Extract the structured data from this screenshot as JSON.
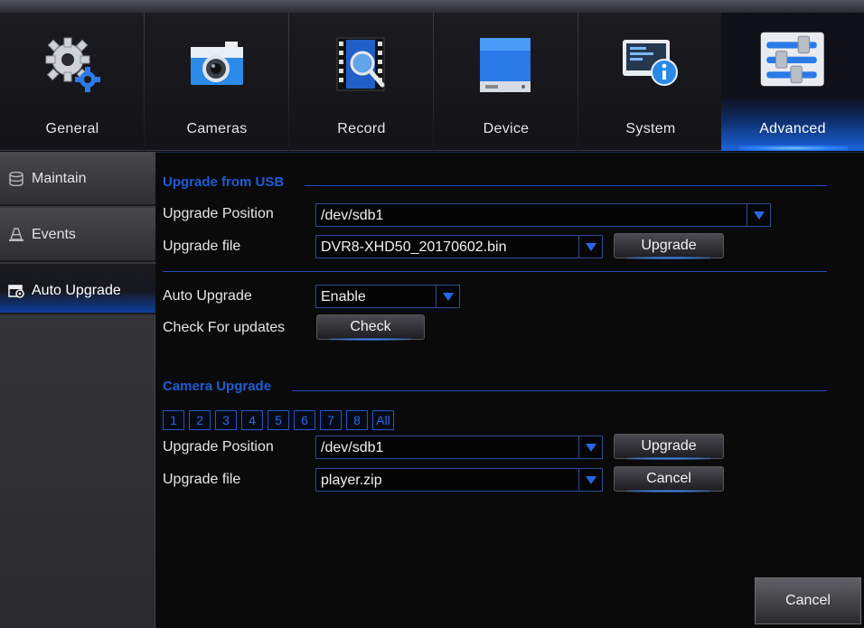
{
  "nav": {
    "tabs": [
      {
        "label": "General",
        "icon": "gear-icon"
      },
      {
        "label": "Cameras",
        "icon": "camera-icon"
      },
      {
        "label": "Record",
        "icon": "record-film-icon"
      },
      {
        "label": "Device",
        "icon": "hard-drive-icon"
      },
      {
        "label": "System",
        "icon": "system-info-icon"
      },
      {
        "label": "Advanced",
        "icon": "sliders-icon"
      }
    ],
    "active_tab": "Advanced"
  },
  "sidebar": {
    "items": [
      {
        "label": "Maintain",
        "icon": "database-icon"
      },
      {
        "label": "Events",
        "icon": "warning-cone-icon"
      },
      {
        "label": "Auto Upgrade",
        "icon": "upgrade-icon"
      }
    ],
    "active_item": "Auto Upgrade"
  },
  "usb_upgrade": {
    "title": "Upgrade from USB",
    "position_label": "Upgrade Position",
    "position_value": "/dev/sdb1",
    "file_label": "Upgrade file",
    "file_value": "DVR8-XHD50_20170602.bin",
    "upgrade_button": "Upgrade"
  },
  "auto_upgrade": {
    "label": "Auto Upgrade",
    "value": "Enable",
    "check_label": "Check For updates",
    "check_button": "Check"
  },
  "camera_upgrade": {
    "title": "Camera Upgrade",
    "channels": [
      "1",
      "2",
      "3",
      "4",
      "5",
      "6",
      "7",
      "8",
      "All"
    ],
    "position_label": "Upgrade Position",
    "position_value": "/dev/sdb1",
    "upgrade_button": "Upgrade",
    "file_label": "Upgrade file",
    "file_value": "player.zip",
    "cancel_button": "Cancel"
  },
  "footer": {
    "cancel_button": "Cancel"
  },
  "colors": {
    "accent": "#1e5cd6",
    "background": "#0a0a0a",
    "active_tab": "#1a5fd4"
  }
}
